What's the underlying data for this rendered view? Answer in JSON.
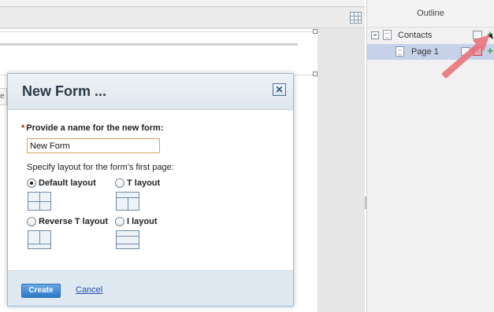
{
  "outline": {
    "title": "Outline",
    "items": [
      {
        "label": "Contacts"
      },
      {
        "label": "Page 1"
      }
    ]
  },
  "dialog": {
    "title": "New Form ...",
    "close_icon": "close-icon",
    "name_label": "Provide a name for the new form:",
    "required_marker": "*",
    "name_value": "New Form",
    "layout_caption": "Specify layout for the form's first page:",
    "layouts": [
      {
        "label": "Default layout",
        "selected": true
      },
      {
        "label": "T layout",
        "selected": false
      },
      {
        "label": "Reverse T layout",
        "selected": false
      },
      {
        "label": "I layout",
        "selected": false
      }
    ],
    "create_label": "Create",
    "cancel_label": "Cancel"
  },
  "annotation": {
    "arrow_color": "#e8747b"
  },
  "accent": {
    "selection": "#c7d2ea",
    "primary_button": "#2b78c7",
    "link": "#1f4ea8"
  }
}
